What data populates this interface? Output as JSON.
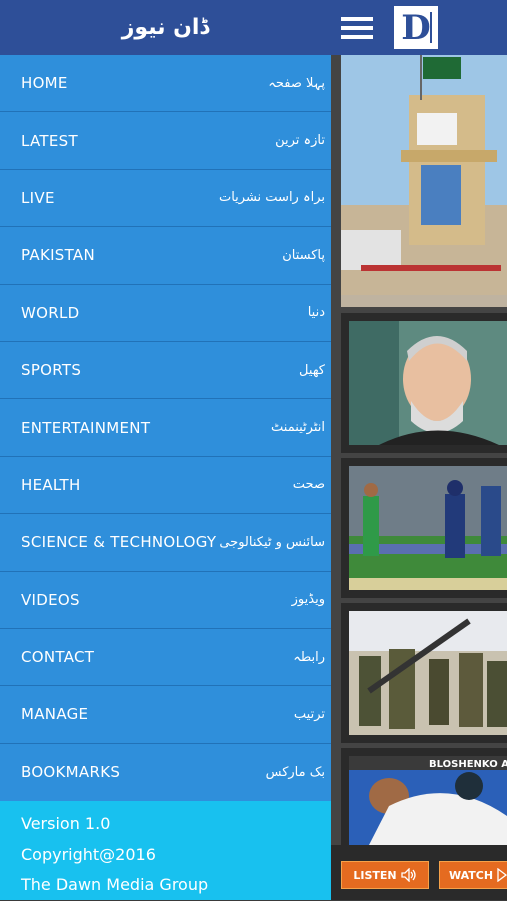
{
  "drawer": {
    "title": "ڈان نیوز",
    "items": [
      {
        "en": "HOME",
        "ur": "پہلا صفحہ"
      },
      {
        "en": "LATEST",
        "ur": "تازہ ترین"
      },
      {
        "en": "LIVE",
        "ur": "براہ راست نشریات"
      },
      {
        "en": "PAKISTAN",
        "ur": "پاکستان"
      },
      {
        "en": "WORLD",
        "ur": "دنیا"
      },
      {
        "en": "SPORTS",
        "ur": "کھیل"
      },
      {
        "en": "ENTERTAINMENT",
        "ur": "انٹرٹینمنٹ"
      },
      {
        "en": "HEALTH",
        "ur": "صحت"
      },
      {
        "en": "SCIENCE & TECHNOLOGY",
        "ur": "سائنس و ٹیکنالوجی"
      },
      {
        "en": "VIDEOS",
        "ur": "ویڈیوز"
      },
      {
        "en": "CONTACT",
        "ur": "رابطہ"
      },
      {
        "en": "MANAGE",
        "ur": "ترتیب"
      },
      {
        "en": "BOOKMARKS",
        "ur": "بک مارکس"
      }
    ],
    "footer": {
      "version": "Version 1.0",
      "copyright": "Copyright@2016",
      "company": "The Dawn Media Group"
    }
  },
  "header": {
    "logo_letter": "D",
    "menu_icon": "hamburger-icon"
  },
  "content": {
    "card3_caption": "BLOSHENKO A"
  },
  "player": {
    "listen_label": "LISTEN",
    "watch_label": "WATCH",
    "listen_icon": "speaker-icon",
    "watch_icon": "play-icon"
  },
  "colors": {
    "header_blue": "#2e4f98",
    "drawer_blue": "#2f8fdb",
    "footer_cyan": "#18c1ef",
    "button_orange": "#e56b20"
  }
}
